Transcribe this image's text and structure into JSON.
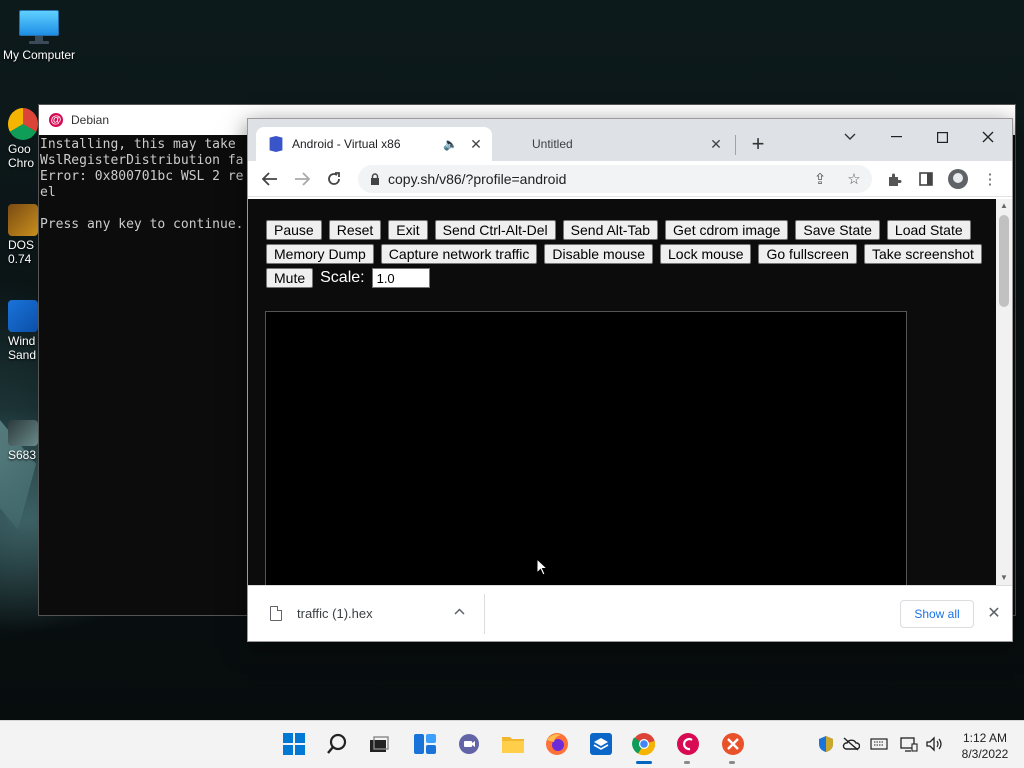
{
  "desktop": {
    "icons": [
      {
        "label": "My Computer"
      },
      {
        "label": "Goo\nChro"
      },
      {
        "label": "DOS\n0.74"
      },
      {
        "label": "Wind\nSand"
      },
      {
        "label": "S683"
      }
    ]
  },
  "debian": {
    "title": "Debian",
    "terminal_lines": "Installing, this may take\nWslRegisterDistribution fa\nError: 0x800701bc WSL 2 re\nel\n\nPress any key to continue."
  },
  "browser": {
    "tabs": [
      {
        "title": "Android - Virtual x86",
        "active": true,
        "audio": true
      },
      {
        "title": "Untitled",
        "active": false
      }
    ],
    "url": "copy.sh/v86/?profile=android"
  },
  "v86": {
    "row1": [
      "Pause",
      "Reset",
      "Exit",
      "Send Ctrl-Alt-Del",
      "Send Alt-Tab",
      "Get cdrom image",
      "Save State",
      "Load State"
    ],
    "row2": [
      "Memory Dump",
      "Capture network traffic",
      "Disable mouse",
      "Lock mouse",
      "Go fullscreen",
      "Take screenshot"
    ],
    "mute_label": "Mute",
    "scale_label": "Scale:",
    "scale_value": "1.0"
  },
  "downloads": {
    "file_name": "traffic (1).hex",
    "show_all_label": "Show all"
  },
  "taskbar": {
    "time": "1:12 AM",
    "date": "8/3/2022",
    "colors": {
      "start": "#0078d4",
      "chrome_red": "#db4437",
      "debian": "#d70a53",
      "x_app": "#e8512a"
    }
  }
}
